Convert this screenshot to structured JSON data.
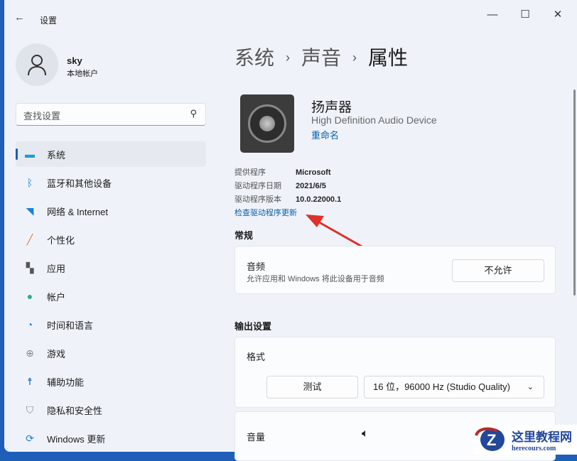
{
  "window": {
    "back_icon": "back-arrow",
    "title": "设置"
  },
  "user": {
    "name": "sky",
    "type": "本地帐户"
  },
  "search": {
    "placeholder": "查找设置"
  },
  "nav": [
    {
      "label": "系统",
      "icon": "display",
      "color": "#1e9ad6"
    },
    {
      "label": "蓝牙和其他设备",
      "icon": "bluetooth",
      "color": "#1a7fd8"
    },
    {
      "label": "网络 & Internet",
      "icon": "wifi",
      "color": "#1a7fd8"
    },
    {
      "label": "个性化",
      "icon": "brush",
      "color": "#e07b39"
    },
    {
      "label": "应用",
      "icon": "apps",
      "color": "#555"
    },
    {
      "label": "帐户",
      "icon": "person",
      "color": "#2ab08a"
    },
    {
      "label": "时间和语言",
      "icon": "clock-globe",
      "color": "#1a7fd8"
    },
    {
      "label": "游戏",
      "icon": "gamepad",
      "color": "#888"
    },
    {
      "label": "辅助功能",
      "icon": "accessibility",
      "color": "#1a6cc8"
    },
    {
      "label": "隐私和安全性",
      "icon": "shield",
      "color": "#888"
    },
    {
      "label": "Windows 更新",
      "icon": "update",
      "color": "#1a7fd8"
    }
  ],
  "breadcrumb": [
    "系统",
    "声音",
    "属性"
  ],
  "device": {
    "name": "扬声器",
    "description": "High Definition Audio Device",
    "rename": "重命名"
  },
  "props": [
    {
      "key": "提供程序",
      "value": "Microsoft"
    },
    {
      "key": "驱动程序日期",
      "value": "2021/6/5"
    },
    {
      "key": "驱动程序版本",
      "value": "10.0.22000.1"
    }
  ],
  "check_update": "检查驱动程序更新",
  "general": {
    "heading": "常规",
    "audio_title": "音频",
    "audio_desc": "允许应用和 Windows 将此设备用于音频",
    "button": "不允许"
  },
  "output": {
    "heading": "输出设置",
    "format_label": "格式",
    "test_button": "测试",
    "format_value": "16 位，96000 Hz (Studio Quality)",
    "volume_label": "音量"
  },
  "watermark": {
    "title": "这里教程网",
    "url": "herecours.com"
  }
}
